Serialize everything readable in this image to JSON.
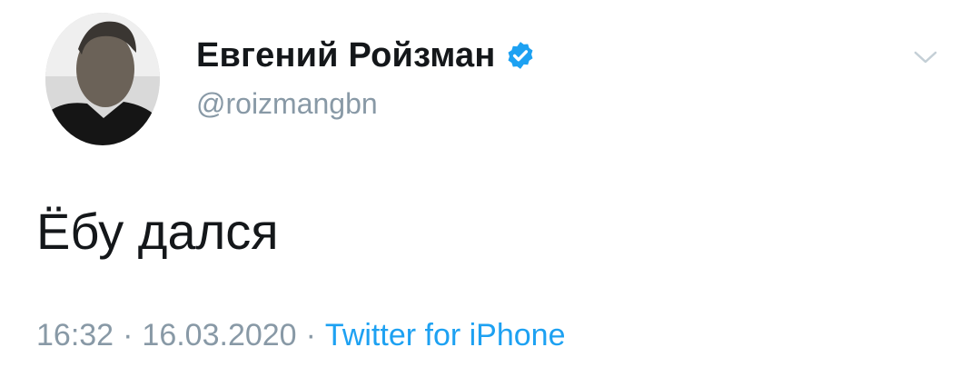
{
  "author": {
    "display_name": "Евгений Ройзман",
    "handle": "@roizmangbn",
    "verified": true
  },
  "icons": {
    "avatar": "user-avatar-photo",
    "verified": "verified-badge-icon",
    "menu": "chevron-down-icon"
  },
  "tweet": {
    "text": "Ёбу дался",
    "time": "16:32",
    "date": "16.03.2020",
    "separator": "·",
    "source": "Twitter for iPhone"
  },
  "colors": {
    "name": "#14171a",
    "secondary": "#8899a6",
    "accent": "#1da1f2"
  }
}
